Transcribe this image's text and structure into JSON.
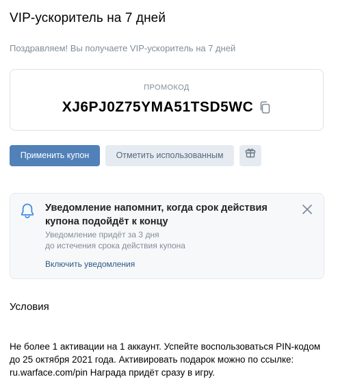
{
  "header": {
    "title": "VIP-ускоритель на 7 дней",
    "subtitle": "Поздравляем! Вы получаете VIP-ускоритель на 7 дней"
  },
  "promo": {
    "label": "ПРОМОКОД",
    "code": "XJ6PJ0Z75YMA51TSD5WC",
    "copy_icon": "copy-icon"
  },
  "actions": {
    "apply_label": "Применить купон",
    "mark_used_label": "Отметить использованным",
    "gift_icon": "gift-icon"
  },
  "notice": {
    "icon": "bell-icon",
    "title": "Уведомление напомнит, когда срок действия купона подойдёт к концу",
    "text_line1": "Уведомление придёт за 3 дня",
    "text_line2": "до истечения срока действия купона",
    "link_label": "Включить уведомления",
    "close_icon": "close-icon"
  },
  "conditions": {
    "title": "Условия",
    "text": "Не более 1 активации на 1 аккаунт. Успейте воспользоваться PIN-кодом до 25 октября 2021 года. Активировать подарок можно по ссылке: ru.warface.com/pin Награда придёт сразу в игру."
  },
  "colors": {
    "primary": "#5181b8",
    "secondary_bg": "#e5ebf1",
    "muted_text": "#818c99",
    "link": "#2a5885",
    "icon_accent": "#3f8ae0"
  }
}
